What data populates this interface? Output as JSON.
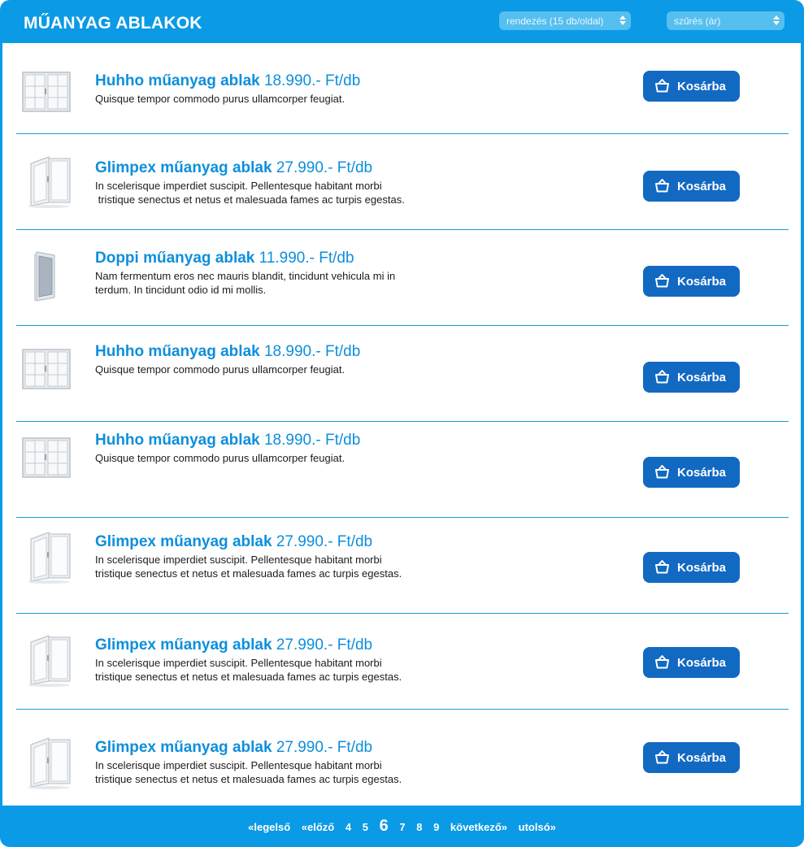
{
  "header": {
    "title": "MŰANYAG ABLAKOK",
    "sort_select": "rendezés (15 db/oldal)",
    "filter_select": "szűrés (ár)"
  },
  "items": [
    {
      "name": "Huhho műanyag ablak",
      "price": "18.990.- Ft/db",
      "desc": [
        "Quisque tempor commodo purus ullamcorper feugiat."
      ],
      "image": "double-window",
      "button": "Kosárba"
    },
    {
      "name": "Glimpex műanyag ablak",
      "price": "27.990.- Ft/db",
      "desc": [
        "In scelerisque imperdiet suscipit. Pellentesque habitant morbi",
        " tristique senectus et netus et malesuada fames ac turpis egestas."
      ],
      "image": "open-window",
      "button": "Kosárba"
    },
    {
      "name": "Doppi műanyag ablak",
      "price": "11.990.-  Ft/db",
      "desc": [
        "Nam fermentum eros nec mauris blandit, tincidunt vehicula mi in",
        "terdum. In tincidunt odio id mi mollis."
      ],
      "image": "single-window",
      "button": "Kosárba"
    },
    {
      "name": "Huhho műanyag ablak",
      "price": "18.990.- Ft/db",
      "desc": [
        "Quisque tempor commodo purus ullamcorper feugiat."
      ],
      "image": "double-window",
      "button": "Kosárba"
    },
    {
      "name": "Huhho műanyag ablak",
      "price": "18.990.- Ft/db",
      "desc": [
        "Quisque tempor commodo purus ullamcorper feugiat."
      ],
      "image": "double-window",
      "button": "Kosárba"
    },
    {
      "name": "Glimpex műanyag ablak",
      "price": "27.990.- Ft/db",
      "desc": [
        "In scelerisque imperdiet suscipit. Pellentesque habitant morbi",
        "tristique senectus et netus et malesuada fames ac turpis egestas."
      ],
      "image": "open-window",
      "button": "Kosárba"
    },
    {
      "name": "Glimpex műanyag ablak",
      "price": "27.990.- Ft/db",
      "desc": [
        "In scelerisque imperdiet suscipit. Pellentesque habitant morbi",
        "tristique senectus et netus et malesuada fames ac turpis egestas."
      ],
      "image": "open-window",
      "button": "Kosárba"
    },
    {
      "name": "Glimpex műanyag ablak",
      "price": "27.990.- Ft/db",
      "desc": [
        "In scelerisque imperdiet suscipit. Pellentesque habitant morbi",
        "tristique senectus et netus et malesuada fames ac turpis egestas."
      ],
      "image": "open-window",
      "button": "Kosárba"
    }
  ],
  "pagination": {
    "first": "«legelső",
    "prev": "«előző",
    "pages": [
      "4",
      "5",
      "6",
      "7",
      "8",
      "9"
    ],
    "current": "6",
    "next": "következő»",
    "last": "utolsó»"
  },
  "colors": {
    "frame": "#0b9ae6",
    "title_text": "#0d8fdc",
    "button": "#1269c2",
    "divider": "#1a9ad8"
  }
}
